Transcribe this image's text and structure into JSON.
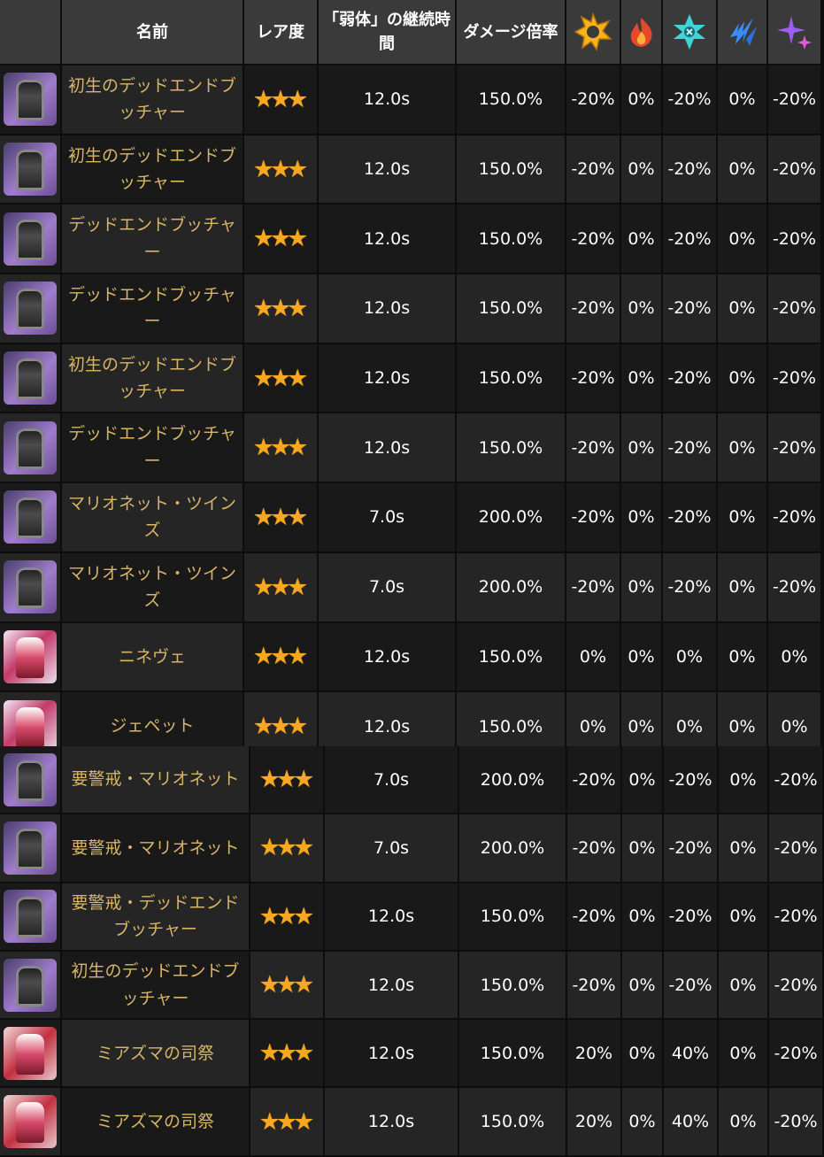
{
  "headers": {
    "name": "名前",
    "rarity": "レア度",
    "duration": "「弱体」の継続時間",
    "damage": "ダメージ倍率"
  },
  "element_icons": [
    "light-burst-icon",
    "fire-icon",
    "ice-crystal-icon",
    "lightning-icon",
    "dark-sparkle-icon"
  ],
  "colors": {
    "name_text": "#d7b565",
    "star": "#f7a823",
    "header_bg": "#3a3a3a"
  },
  "rows": [
    {
      "name": "初生のデッドエンドブッチャー",
      "stars": "★★★",
      "duration": "12.0s",
      "damage": "150.0%",
      "e1": "-20%",
      "e2": "0%",
      "e3": "-20%",
      "e4": "0%",
      "e5": "-20%"
    },
    {
      "name": "初生のデッドエンドブッチャー",
      "stars": "★★★",
      "duration": "12.0s",
      "damage": "150.0%",
      "e1": "-20%",
      "e2": "0%",
      "e3": "-20%",
      "e4": "0%",
      "e5": "-20%"
    },
    {
      "name": "デッドエンドブッチャー",
      "stars": "★★★",
      "duration": "12.0s",
      "damage": "150.0%",
      "e1": "-20%",
      "e2": "0%",
      "e3": "-20%",
      "e4": "0%",
      "e5": "-20%"
    },
    {
      "name": "デッドエンドブッチャー",
      "stars": "★★★",
      "duration": "12.0s",
      "damage": "150.0%",
      "e1": "-20%",
      "e2": "0%",
      "e3": "-20%",
      "e4": "0%",
      "e5": "-20%"
    },
    {
      "name": "初生のデッドエンドブッチャー",
      "stars": "★★★",
      "duration": "12.0s",
      "damage": "150.0%",
      "e1": "-20%",
      "e2": "0%",
      "e3": "-20%",
      "e4": "0%",
      "e5": "-20%"
    },
    {
      "name": "デッドエンドブッチャー",
      "stars": "★★★",
      "duration": "12.0s",
      "damage": "150.0%",
      "e1": "-20%",
      "e2": "0%",
      "e3": "-20%",
      "e4": "0%",
      "e5": "-20%"
    },
    {
      "name": "マリオネット・ツインズ",
      "stars": "★★★",
      "duration": "7.0s",
      "damage": "200.0%",
      "e1": "-20%",
      "e2": "0%",
      "e3": "-20%",
      "e4": "0%",
      "e5": "-20%"
    },
    {
      "name": "マリオネット・ツインズ",
      "stars": "★★★",
      "duration": "7.0s",
      "damage": "200.0%",
      "e1": "-20%",
      "e2": "0%",
      "e3": "-20%",
      "e4": "0%",
      "e5": "-20%"
    },
    {
      "name": "ニネヴェ",
      "stars": "★★★",
      "duration": "12.0s",
      "damage": "150.0%",
      "e1": "0%",
      "e2": "0%",
      "e3": "0%",
      "e4": "0%",
      "e5": "0%"
    },
    {
      "name": "ジェペット",
      "stars": "★★★",
      "duration": "12.0s",
      "damage": "150.0%",
      "e1": "0%",
      "e2": "0%",
      "e3": "0%",
      "e4": "0%",
      "e5": "0%"
    },
    {
      "name": "要警戒・マリオネット",
      "stars": "★★★",
      "duration": "7.0s",
      "damage": "200.0%",
      "e1": "-20%",
      "e2": "0%",
      "e3": "-20%",
      "e4": "0%",
      "e5": "-20%"
    },
    {
      "name": "要警戒・マリオネット",
      "stars": "★★★",
      "duration": "7.0s",
      "damage": "200.0%",
      "e1": "-20%",
      "e2": "0%",
      "e3": "-20%",
      "e4": "0%",
      "e5": "-20%"
    },
    {
      "name": "要警戒・デッドエンドブッチャー",
      "stars": "★★★",
      "duration": "12.0s",
      "damage": "150.0%",
      "e1": "-20%",
      "e2": "0%",
      "e3": "-20%",
      "e4": "0%",
      "e5": "-20%"
    },
    {
      "name": "初生のデッドエンドブッチャー",
      "stars": "★★★",
      "duration": "12.0s",
      "damage": "150.0%",
      "e1": "-20%",
      "e2": "0%",
      "e3": "-20%",
      "e4": "0%",
      "e5": "-20%"
    },
    {
      "name": "ミアズマの司祭",
      "stars": "★★★",
      "duration": "12.0s",
      "damage": "150.0%",
      "e1": "20%",
      "e2": "0%",
      "e3": "40%",
      "e4": "0%",
      "e5": "-20%"
    },
    {
      "name": "ミアズマの司祭",
      "stars": "★★★",
      "duration": "12.0s",
      "damage": "150.0%",
      "e1": "20%",
      "e2": "0%",
      "e3": "40%",
      "e4": "0%",
      "e5": "-20%"
    }
  ]
}
